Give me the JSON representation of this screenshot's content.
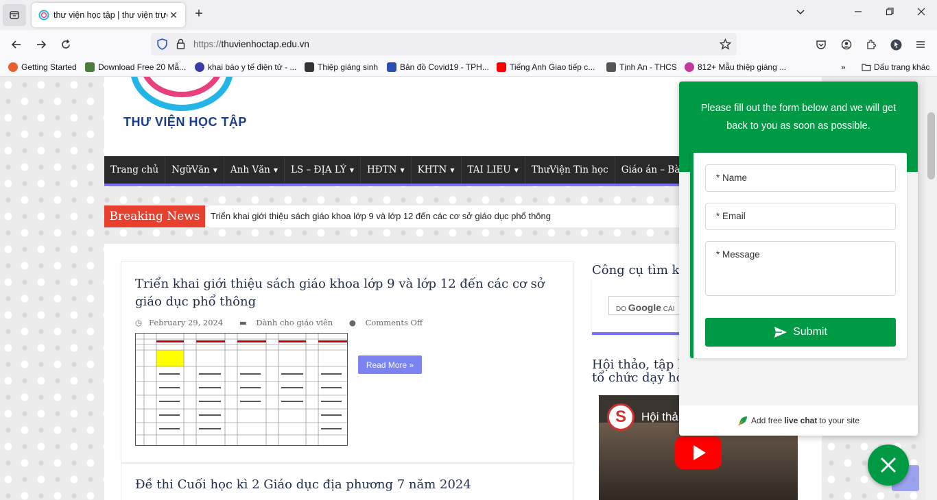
{
  "browser": {
    "tab_title": "thư viện học tập | thư viện trực",
    "url_scheme": "https://",
    "url_host": "thuvienhoctap.edu.vn",
    "bookmarks": [
      {
        "label": "Getting Started",
        "color": "#e8612c"
      },
      {
        "label": "Download Free 20 Mẫ...",
        "color": "#4a7d3b"
      },
      {
        "label": "khai báo y tế điện tử - ...",
        "color": "#3a3aa8"
      },
      {
        "label": "Thiệp giáng sinh",
        "color": "#333333"
      },
      {
        "label": "Bản đồ Covid19 - TPH...",
        "color": "#2a4fb0"
      },
      {
        "label": "Tiếng Anh Giao tiếp c...",
        "color": "#ff0000"
      },
      {
        "label": "Tịnh An - THCS",
        "color": "#555555"
      },
      {
        "label": "812+ Mẫu thiệp giáng ...",
        "color": "#c23a9c"
      }
    ],
    "bookmarks_folder": "Dấu trang khác"
  },
  "site": {
    "logo_text": "THƯ VIỆN HỌC TẬP",
    "menu": [
      {
        "label": "Trang chủ",
        "dropdown": false
      },
      {
        "label": "NgữVăn",
        "dropdown": true
      },
      {
        "label": "Anh Văn",
        "dropdown": true
      },
      {
        "label": "LS – ĐỊA LÝ",
        "dropdown": true
      },
      {
        "label": "HĐTN",
        "dropdown": true
      },
      {
        "label": "KHTN",
        "dropdown": true
      },
      {
        "label": "TAI LIEU",
        "dropdown": true
      },
      {
        "label": "ThưViện Tin học",
        "dropdown": false
      },
      {
        "label": "Giáo án – Bài Giản",
        "dropdown": false
      }
    ],
    "breaking_label": "Breaking News",
    "breaking_text": "Triển khai giới thiệu sách giáo khoa lớp 9 và lớp 12 đến các cơ sở giáo dục phổ thông"
  },
  "post": {
    "title": "Triển khai giới thiệu sách giáo khoa lớp 9 và lớp 12 đến các cơ sở giáo dục phổ thông",
    "date": "February 29, 2024",
    "category": "Dành cho giáo viên",
    "comments": "Comments Off",
    "read_more": "Read More »"
  },
  "post2": {
    "title": "Đề thi Cuối học kì 2 Giáo dục địa phương 7 năm 2024"
  },
  "sidebar": {
    "search_heading": "Công cụ tìm ki",
    "search_prefix": "DO",
    "search_brand": "Google",
    "search_suffix": "CÁI",
    "hoithao_line1": "Hội thảo, tập h",
    "hoithao_line2": "tổ chức dạy họ",
    "video_title": "Hội thả"
  },
  "widget": {
    "message": "Please fill out the form below and we will get back to you as soon as possible.",
    "name_placeholder": "* Name",
    "email_placeholder": "* Email",
    "message_placeholder": "* Message",
    "submit_label": "Submit",
    "footer_pre": "Add free",
    "footer_bold": "live chat",
    "footer_post": "to your site",
    "accent": "#009a44"
  }
}
